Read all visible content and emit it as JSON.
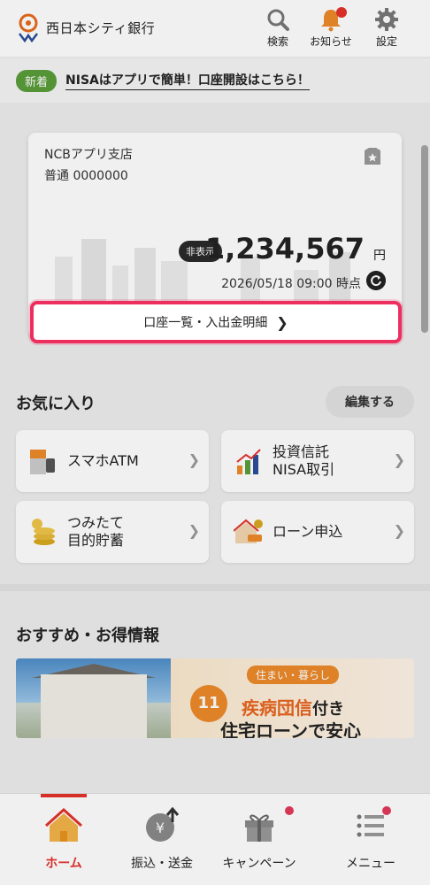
{
  "header": {
    "bank_name": "西日本シティ銀行",
    "search_label": "検索",
    "notice_label": "お知らせ",
    "settings_label": "設定"
  },
  "news": {
    "badge": "新着",
    "text": "NISAはアプリで簡単！口座開設はこちら！"
  },
  "account": {
    "branch": "NCBアプリ支店",
    "number": "普通 0000000",
    "hide_label": "非表示",
    "balance": "1,234,567",
    "currency": "円",
    "timestamp": "2026/05/18 09:00 時点",
    "statement_label": "口座一覧・入出金明細"
  },
  "favorites": {
    "title": "お気に入り",
    "edit_label": "編集する",
    "items": [
      {
        "label": "スマホATM",
        "icon": "atm-icon"
      },
      {
        "label": "投資信託\nNISA取引",
        "icon": "chart-icon"
      },
      {
        "label": "つみたて\n目的貯蓄",
        "icon": "coins-icon"
      },
      {
        "label": "ローン申込",
        "icon": "house-car-icon"
      }
    ]
  },
  "recommend": {
    "title": "おすすめ・お得情報",
    "banner_tag": "住まい・暮らし",
    "banner_badge": "11",
    "banner_line1_main": "疾病団信",
    "banner_line1_sub": "付き",
    "banner_line2": "住宅ローンで安心"
  },
  "bottom_nav": {
    "home": "ホーム",
    "transfer": "振込・送金",
    "campaign": "キャンペーン",
    "menu": "メニュー"
  },
  "colors": {
    "accent_red": "#e4322b",
    "highlight_pink": "#ec2f5f",
    "badge_green": "#5a9d3a",
    "banner_orange": "#ec8a2a"
  }
}
